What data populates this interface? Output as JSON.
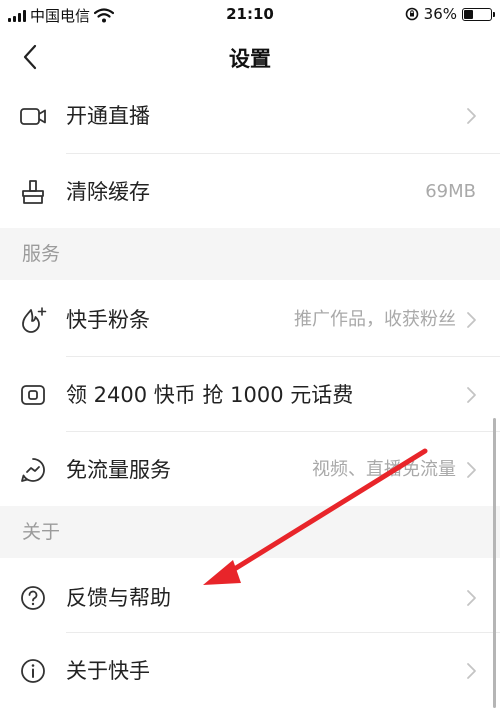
{
  "status_bar": {
    "carrier": "中国电信",
    "time": "21:10",
    "battery_percent": "36%",
    "battery_level": 0.36
  },
  "nav": {
    "title": "设置"
  },
  "rows": [
    {
      "label": "开通直播",
      "value": ""
    },
    {
      "label": "清除缓存",
      "value": "69MB"
    },
    {
      "label": "快手粉条",
      "value": "推广作品，收获粉丝"
    },
    {
      "label": "领 2400 快币 抢 1000 元话费",
      "value": ""
    },
    {
      "label": "免流量服务",
      "value": "视频、直播免流量"
    },
    {
      "label": "反馈与帮助",
      "value": ""
    },
    {
      "label": "关于快手",
      "value": ""
    }
  ],
  "sections": [
    {
      "title": "服务"
    },
    {
      "title": "关于"
    }
  ],
  "colors": {
    "annotation_arrow": "#e8252a",
    "section_bg": "#f5f5f5",
    "secondary_text": "#a9a9a9"
  }
}
